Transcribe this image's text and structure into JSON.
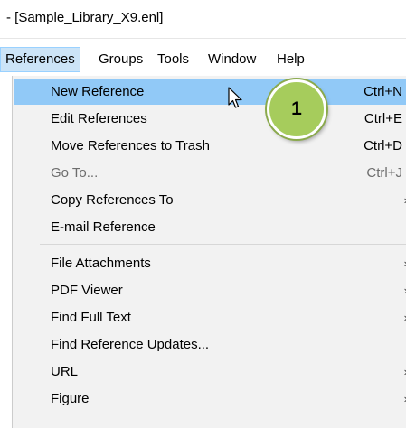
{
  "window": {
    "title": "- [Sample_Library_X9.enl]"
  },
  "menubar": {
    "items": [
      {
        "label": "References",
        "active": true
      },
      {
        "label": "Groups"
      },
      {
        "label": "Tools"
      },
      {
        "label": "Window"
      },
      {
        "label": "Help"
      }
    ]
  },
  "dropdown": {
    "items": [
      {
        "label": "New Reference",
        "shortcut": "Ctrl+N"
      },
      {
        "label": "Edit References",
        "shortcut": "Ctrl+E"
      },
      {
        "label": "Move References to Trash",
        "shortcut": "Ctrl+D"
      },
      {
        "label": "Go To...",
        "shortcut": "Ctrl+J"
      },
      {
        "label": "Copy References To",
        "arrow": "›"
      },
      {
        "label": "E-mail Reference"
      },
      {
        "label": "File Attachments",
        "arrow": "›"
      },
      {
        "label": "PDF Viewer",
        "arrow": "›"
      },
      {
        "label": "Find Full Text",
        "arrow": "›"
      },
      {
        "label": "Find Reference Updates..."
      },
      {
        "label": "URL",
        "arrow": "›"
      },
      {
        "label": "Figure",
        "arrow": "›"
      }
    ]
  },
  "annotation": {
    "step": "1"
  },
  "colors": {
    "hover": "#91c9f7",
    "badge": "#a6cc5c",
    "menu_bg": "#f2f2f2"
  }
}
